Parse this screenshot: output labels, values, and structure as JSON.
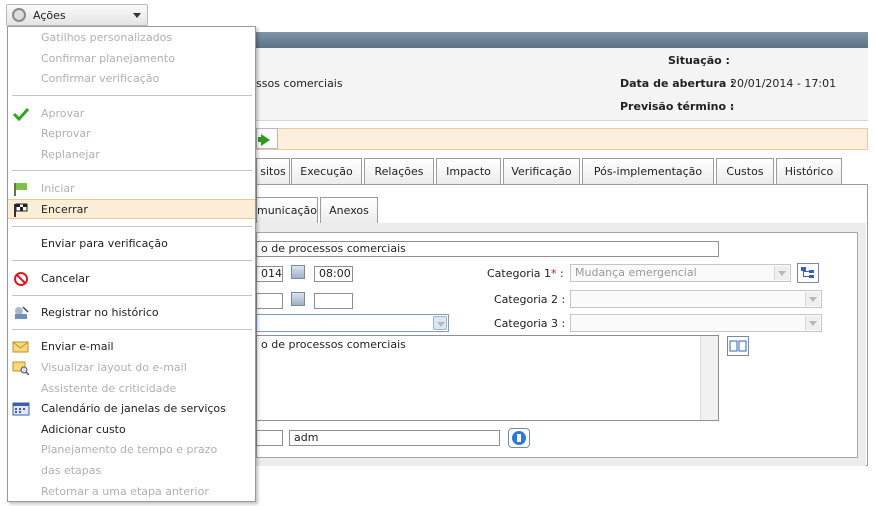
{
  "toolbar": {
    "actions_label": "Ações"
  },
  "info": {
    "title_fragment": "ssos comerciais",
    "status_label": "Situação :",
    "status_value": "",
    "opened_label": "Data de abertura :",
    "opened_value": "20/01/2014 - 17:01",
    "due_label": "Previsão término :",
    "due_value": "-"
  },
  "tabs": [
    "sitos",
    "Execução",
    "Relações",
    "Impacto",
    "Verificação",
    "Pós-implementação",
    "Custos",
    "Histórico"
  ],
  "subtabs": [
    "municação",
    "Anexos"
  ],
  "form": {
    "title_value": "o de processos comerciais",
    "start_date_fragment": "014",
    "start_time": "08:00",
    "end_date_value": "",
    "end_time": "",
    "category1_label": "Categoria 1",
    "category1_required": "*",
    "category1_colon": ":",
    "category1_value": "Mudança emergencial",
    "category2_label": "Categoria 2 :",
    "category2_value": "",
    "category3_label": "Categoria 3 :",
    "category3_value": "",
    "description_value": "o de processos comerciais",
    "user_value": "adm"
  },
  "menu": {
    "items": [
      {
        "label": "Gatilhos personalizados",
        "enabled": false
      },
      {
        "label": "Confirmar planejamento",
        "enabled": false
      },
      {
        "label": "Confirmar verificação",
        "enabled": false
      },
      {
        "label": "Aprovar",
        "enabled": false,
        "icon": "green-check-icon"
      },
      {
        "label": "Reprovar",
        "enabled": false
      },
      {
        "label": "Replanejar",
        "enabled": false
      },
      {
        "label": "Iniciar",
        "enabled": false,
        "icon": "start-flag-icon"
      },
      {
        "label": "Encerrar",
        "enabled": true,
        "icon": "finish-flag-icon"
      },
      {
        "label": "Enviar para verificação",
        "enabled": true
      },
      {
        "label": "Cancelar",
        "enabled": true,
        "icon": "cancel-icon"
      },
      {
        "label": "Registrar no histórico",
        "enabled": true,
        "icon": "history-icon"
      },
      {
        "label": "Enviar e-mail",
        "enabled": true,
        "icon": "envelope-icon"
      },
      {
        "label": "Visualizar layout do e-mail",
        "enabled": false,
        "icon": "envelope-search-icon"
      },
      {
        "label": "Assistente de criticidade",
        "enabled": false
      },
      {
        "label": "Calendário de janelas de serviços",
        "enabled": true,
        "icon": "calendar-icon"
      },
      {
        "label": "Adicionar custo",
        "enabled": true
      },
      {
        "label": "Planejamento de tempo e prazo",
        "enabled": false
      },
      {
        "label": "das etapas",
        "enabled": false
      },
      {
        "label": "Retornar a uma etapa anterior",
        "enabled": false
      }
    ]
  },
  "colors": {
    "header_bar": "#6b7f95",
    "highlight": "#fcedd6",
    "accent_green": "#2f9a1e",
    "disabled_text": "#b0b0b0"
  }
}
